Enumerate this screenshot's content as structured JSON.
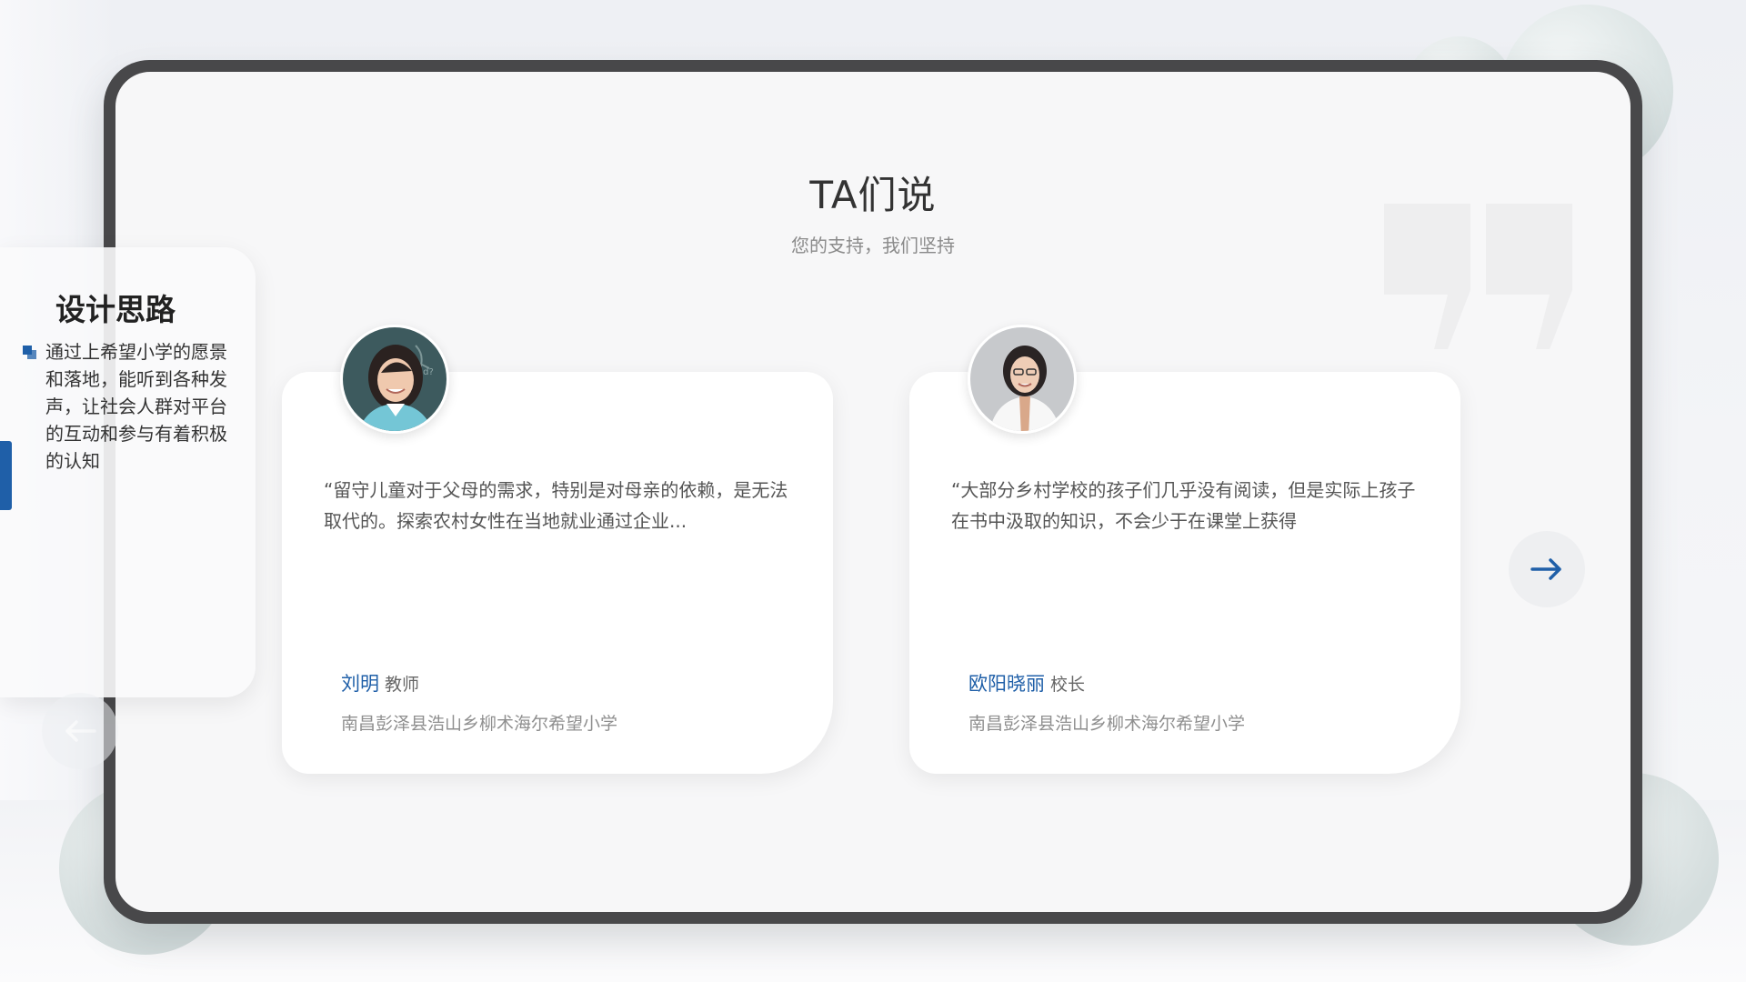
{
  "section": {
    "title": "TA们说",
    "subtitle": "您的支持，我们坚持"
  },
  "testimonials": [
    {
      "quote": "“留守儿童对于父母的需求，特别是对母亲的依赖，是无法取代的。探索农村女性在当地就业通过企业...",
      "name": "刘明",
      "role": "教师",
      "school": "南昌彭泽县浩山乡柳术海尔希望小学"
    },
    {
      "quote": "“大部分乡村学校的孩子们几乎没有阅读，但是实际上孩子在书中汲取的知识，不会少于在课堂上获得",
      "name": "欧阳晓丽",
      "role": "校长",
      "school": "南昌彭泽县浩山乡柳术海尔希望小学"
    }
  ],
  "design_panel": {
    "title": "设计思路",
    "text": "通过上希望小学的愿景和落地，能听到各种发声，让社会人群对平台的互动和参与有着积极的认知"
  },
  "navigation": {
    "prev_icon": "arrow-left-icon",
    "next_icon": "arrow-right-icon"
  },
  "colors": {
    "accent": "#1f5fa8",
    "device_frame": "#48484a",
    "screen_bg": "#f7f7f8"
  }
}
